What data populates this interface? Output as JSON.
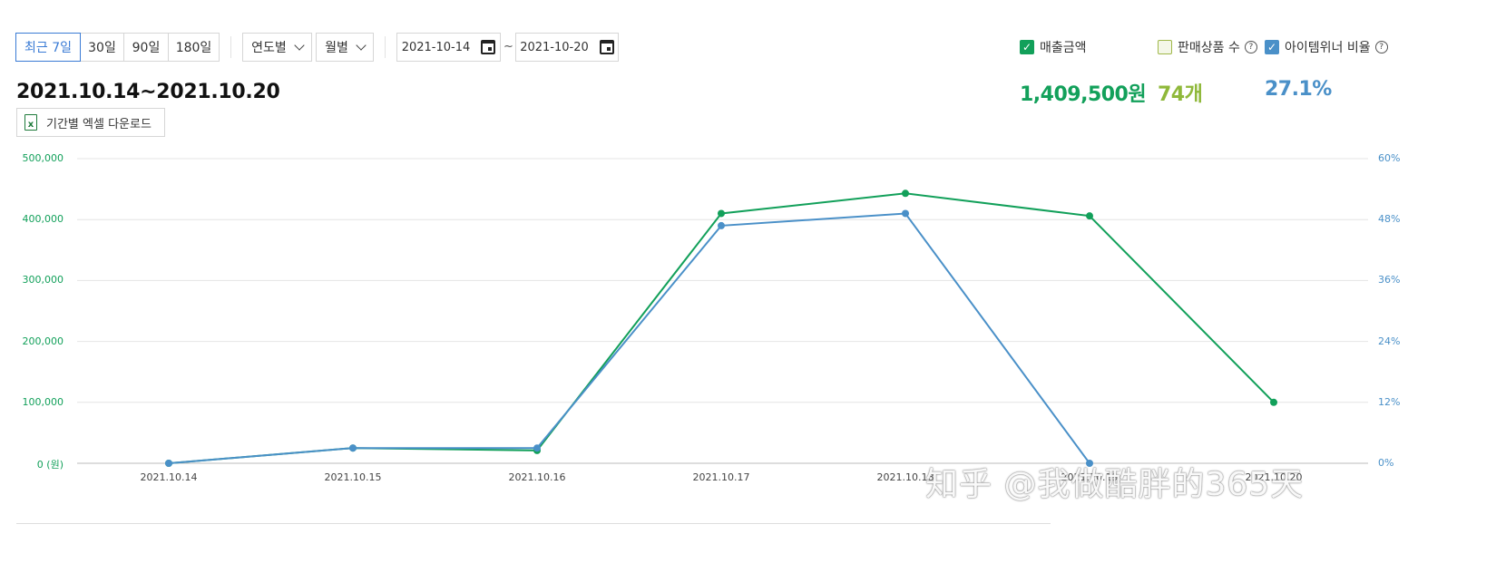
{
  "period_buttons": [
    {
      "label": "최근 7일",
      "active": true
    },
    {
      "label": "30일",
      "active": false
    },
    {
      "label": "90일",
      "active": false
    },
    {
      "label": "180일",
      "active": false
    }
  ],
  "dropdowns": {
    "year_label": "연도별",
    "month_label": "월별"
  },
  "date_range": {
    "start": "2021-10-14",
    "sep": "~",
    "end": "2021-10-20"
  },
  "range_title": "2021.10.14~2021.10.20",
  "excel_button": "기간별 엑셀 다운로드",
  "excel_icon": "excel-file-icon",
  "legend": [
    {
      "label": "매출금액",
      "checked": true,
      "color": "#12a05a",
      "help": false
    },
    {
      "label": "판매상품 수",
      "checked": false,
      "color": "#a0b84a",
      "help": true
    },
    {
      "label": "아이템위너 비율",
      "checked": true,
      "color": "#4a90c8",
      "help": true
    }
  ],
  "metrics": [
    {
      "value": "1,409,500원",
      "color": "#12a05a"
    },
    {
      "value": "74개",
      "color": "#8fb83a"
    },
    {
      "value": "27.1%",
      "color": "#4a90c8"
    }
  ],
  "watermark": "知乎 @我做酷胖的365天",
  "chart_data": {
    "type": "line",
    "categories": [
      "2021.10.14",
      "2021.10.15",
      "2021.10.16",
      "2021.10.17",
      "2021.10.18",
      "2021.10.19",
      "2021.10.20"
    ],
    "y_left_ticks": [
      "0 (원)",
      "100,000",
      "200,000",
      "300,000",
      "400,000",
      "500,000"
    ],
    "y_right_ticks": [
      "0%",
      "12%",
      "24%",
      "36%",
      "48%",
      "60%"
    ],
    "ylim_left": [
      0,
      500000
    ],
    "ylim_right": [
      0,
      60
    ],
    "grid": true,
    "series": [
      {
        "name": "매출금액",
        "axis": "left",
        "color": "#12a05a",
        "values": [
          0,
          25000,
          21000,
          410000,
          443000,
          406000,
          100000
        ]
      },
      {
        "name": "아이템위너 비율",
        "axis": "right",
        "color": "#4a90c8",
        "values": [
          0,
          3.0,
          3.0,
          46.8,
          49.2,
          0,
          null
        ]
      }
    ]
  }
}
